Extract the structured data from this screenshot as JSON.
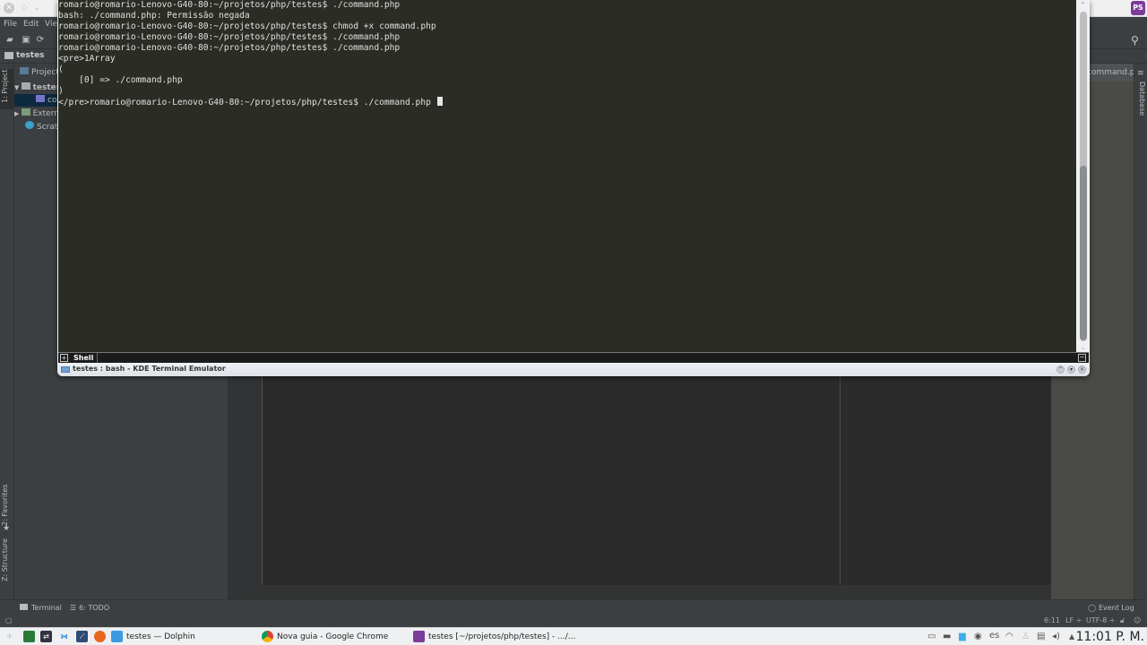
{
  "ide": {
    "menu": [
      "File",
      "Edit",
      "View"
    ],
    "breadcrumb": "testes",
    "left_stripe": {
      "project": "1: Project",
      "favorites": "2: Favorites",
      "structure": "Z: Structure"
    },
    "project_tree": [
      {
        "label": "Project",
        "indent": 0,
        "selected": false
      },
      {
        "label": "testes",
        "indent": 1,
        "selected": false
      },
      {
        "label": "command.php",
        "indent": 2,
        "selected": true
      },
      {
        "label": "External Libraries",
        "indent": 1,
        "selected": false
      },
      {
        "label": "Scratches and Consoles",
        "indent": 1,
        "selected": false
      }
    ],
    "editor_tab": "command.php",
    "right_stripe": {
      "database": "Database"
    },
    "bottom_tools": {
      "terminal": "Terminal",
      "todo": "6: TODO",
      "event_log": "Event Log"
    },
    "status": {
      "position": "6:11",
      "line_sep": "LF ÷",
      "encoding": "UTF-8 ÷"
    }
  },
  "terminal": {
    "lines": [
      "romario@romario-Lenovo-G40-80:~/projetos/php/testes$ ./command.php",
      "bash: ./command.php: Permissão negada",
      "romario@romario-Lenovo-G40-80:~/projetos/php/testes$ chmod +x command.php",
      "romario@romario-Lenovo-G40-80:~/projetos/php/testes$ ./command.php",
      "romario@romario-Lenovo-G40-80:~/projetos/php/testes$ ./command.php",
      "<pre>1Array",
      "(",
      "    [0] => ./command.php",
      ")",
      "</pre>romario@romario-Lenovo-G40-80:~/projetos/php/testes$ ./command.php "
    ],
    "tab_label": "Shell",
    "window_title": "testes : bash - KDE Terminal Emulator"
  },
  "taskbar": {
    "tasks": [
      {
        "label": "testes — Dolphin",
        "icon": "folder-icon"
      },
      {
        "label": "Nova guia - Google Chrome",
        "icon": "chrome-icon"
      },
      {
        "label": "testes [~/projetos/php/testes] - .../...",
        "icon": "phpstorm-icon"
      }
    ],
    "keyboard_layout": "es",
    "clock": "11:01 P. M."
  }
}
